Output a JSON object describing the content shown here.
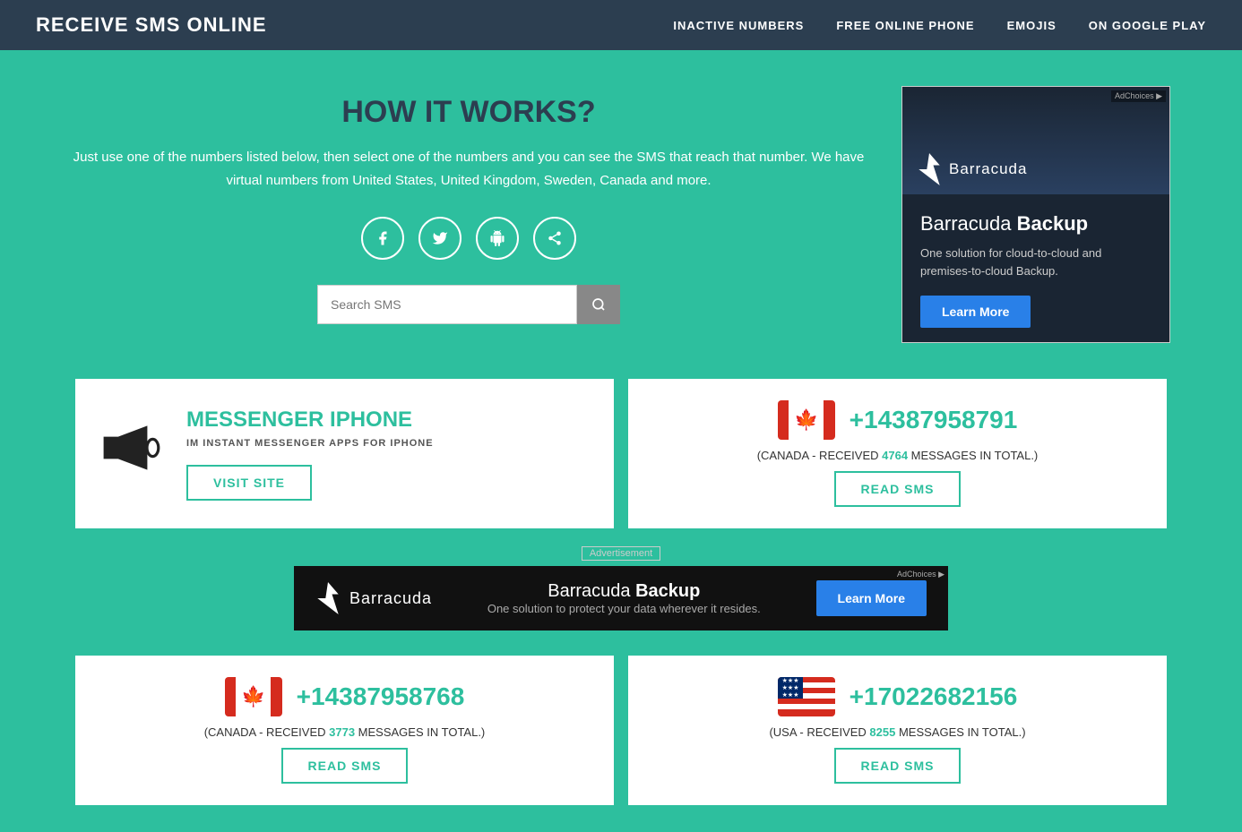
{
  "nav": {
    "logo": "RECEIVE SMS ONLINE",
    "links": [
      {
        "label": "INACTIVE NUMBERS",
        "name": "inactive-numbers-link"
      },
      {
        "label": "FREE ONLINE PHONE",
        "name": "free-online-phone-link"
      },
      {
        "label": "EMOJIS",
        "name": "emojis-link"
      },
      {
        "label": "ON GOOGLE PLAY",
        "name": "on-google-play-link"
      }
    ]
  },
  "hero": {
    "title": "HOW IT WORKS?",
    "description": "Just use one of the numbers listed below, then select one of the\nnumbers and you can see the SMS that reach that number.\nWe have virtual numbers from United States, United Kingdom,\nSweden, Canada and more.",
    "search_placeholder": "Search SMS",
    "social_icons": [
      {
        "name": "facebook-icon",
        "symbol": "f"
      },
      {
        "name": "twitter-icon",
        "symbol": "t"
      },
      {
        "name": "android-icon",
        "symbol": "⚙"
      },
      {
        "name": "share-icon",
        "symbol": "⤴"
      }
    ]
  },
  "ad_sidebar": {
    "choices_label": "AdChoices ▶",
    "brand": "Barracuda",
    "headline_plain": "Barracuda ",
    "headline_bold": "Backup",
    "subtext": "One solution for cloud-to-cloud\nand premises-to-cloud Backup.",
    "btn_label": "Learn More"
  },
  "messenger_card": {
    "title": "MESSENGER IPHONE",
    "subtitle": "IM INSTANT MESSENGER APPS FOR IPHONE",
    "btn_label": "Visit Site"
  },
  "phone_card_1": {
    "number": "+14387958791",
    "country": "CANADA",
    "count": "4764",
    "meta_before": "(CANADA - RECEIVED ",
    "meta_after": " MESSAGES IN TOTAL.)",
    "btn_label": "Read SMS",
    "flag": "canada"
  },
  "ad_banner": {
    "label": "Advertisement",
    "choices_label": "AdChoices ▶",
    "headline_plain": "Barracuda ",
    "headline_bold": "Backup",
    "subtext": "One solution to protect your data wherever it resides.",
    "btn_label": "Learn More"
  },
  "phone_card_2": {
    "number": "+14387958768",
    "country": "CANADA",
    "count": "3773",
    "meta_before": "(CANADA - RECEIVED ",
    "meta_after": " MESSAGES IN TOTAL.)",
    "btn_label": "Read SMS",
    "flag": "canada"
  },
  "phone_card_3": {
    "number": "+17022682156",
    "country": "USA",
    "count": "8255",
    "meta_before": "(USA - RECEIVED ",
    "meta_after": " MESSAGES IN TOTAL.)",
    "btn_label": "Read SMS",
    "flag": "usa"
  },
  "colors": {
    "teal": "#2dbf9e",
    "dark": "#2c3e50",
    "red": "#d52b1e"
  }
}
